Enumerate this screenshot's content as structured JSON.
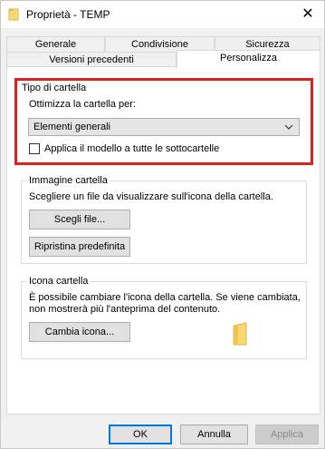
{
  "window": {
    "title": "Proprietà - TEMP",
    "close_glyph": "✕"
  },
  "tabs": {
    "row_back": [
      {
        "label": "Generale"
      },
      {
        "label": "Condivisione"
      },
      {
        "label": "Sicurezza"
      }
    ],
    "row_front": [
      {
        "label": "Versioni precedenti"
      },
      {
        "label": "Personalizza",
        "active": true
      }
    ]
  },
  "folder_type": {
    "group_title": "Tipo di cartella",
    "optimize_label": "Ottimizza la cartella per:",
    "optimize_value": "Elementi generali",
    "apply_template_label": "Applica il modello a tutte le sottocartelle",
    "apply_template_checked": false
  },
  "folder_picture": {
    "group_title": "Immagine cartella",
    "description": "Scegliere un file da visualizzare sull'icona della cartella.",
    "choose_file_label": "Scegli file...",
    "restore_default_label": "Ripristina predefinita"
  },
  "folder_icon": {
    "group_title": "Icona cartella",
    "description_line1": "È possibile cambiare l'icona della cartella. Se viene cambiata,",
    "description_line2": "non mostrerà più l'anteprima del contenuto.",
    "change_icon_label": "Cambia icona...",
    "icon": "folder-icon"
  },
  "footer": {
    "ok_label": "OK",
    "cancel_label": "Annulla",
    "apply_label": "Applica",
    "apply_enabled": false
  },
  "colors": {
    "highlight_border": "#e02020",
    "folder_yellow": "#f8d775",
    "focus_blue": "#0078d7"
  }
}
